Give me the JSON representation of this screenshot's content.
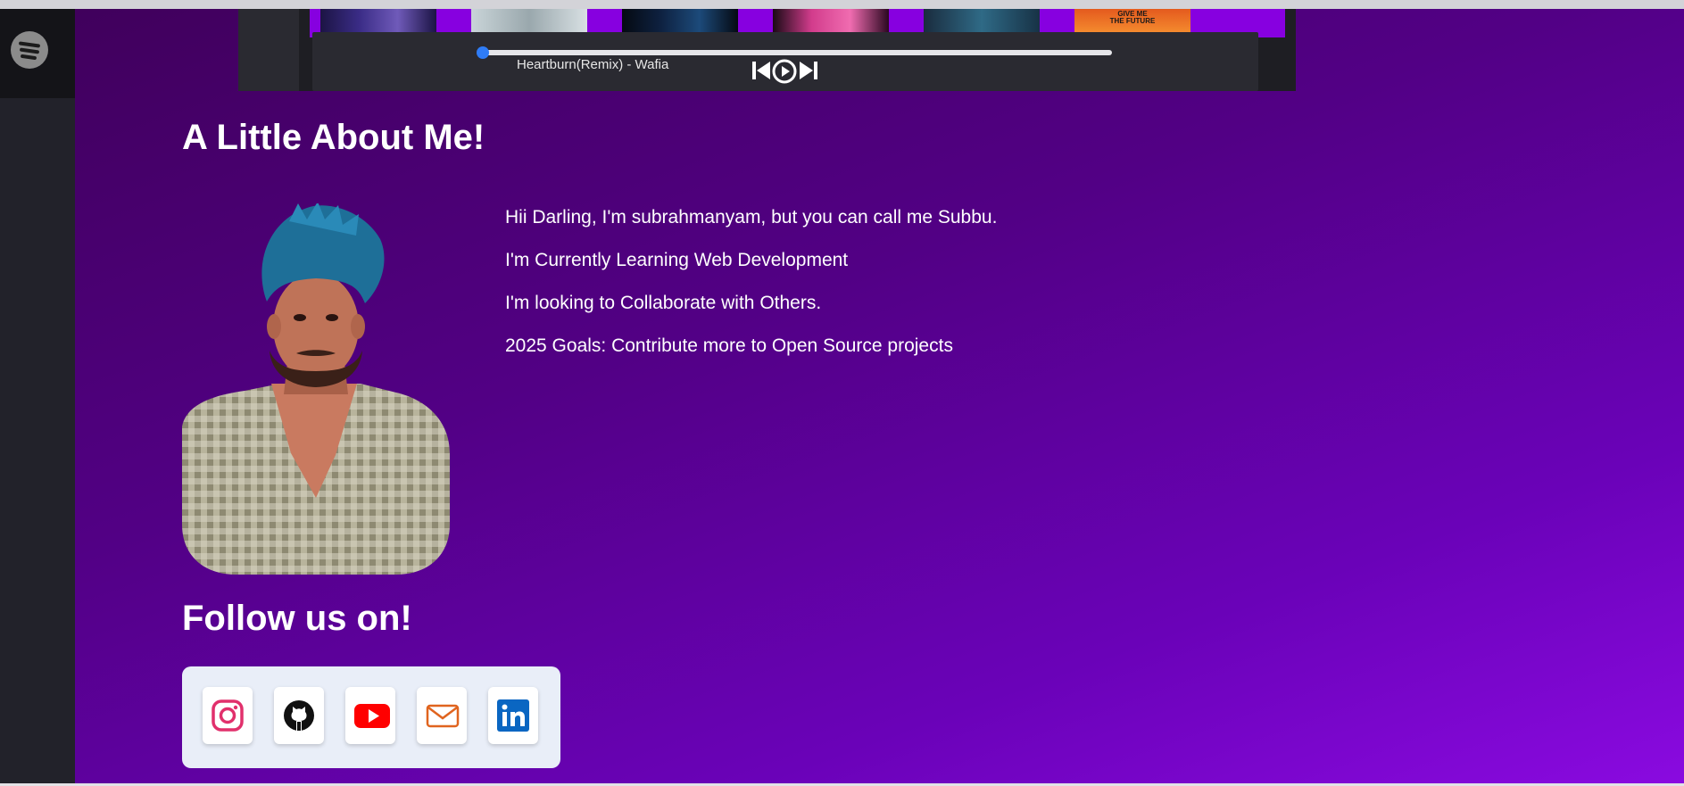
{
  "player": {
    "song_title": "Heartburn(Remix) - Wafia",
    "progress": 0,
    "cover_text": "GIVE ME\nTHE FUTURE"
  },
  "about": {
    "heading": "A Little About Me!",
    "lines": [
      "Hii Darling, I'm subrahmanyam, but you can call me Subbu.",
      "I'm Currently Learning Web Development",
      "I'm looking to Collaborate with Others.",
      "2025 Goals: Contribute more to Open Source projects"
    ]
  },
  "follow": {
    "heading": "Follow us on!",
    "icons": [
      "instagram-icon",
      "github-icon",
      "youtube-icon",
      "mail-icon",
      "linkedin-icon"
    ]
  },
  "colors": {
    "accent": "#8700e0",
    "background_start": "#40005c",
    "background_end": "#8a0ae0",
    "instagram": "#e1306c",
    "youtube": "#ff0000",
    "mail": "#e0641f",
    "linkedin": "#0a66c2"
  }
}
